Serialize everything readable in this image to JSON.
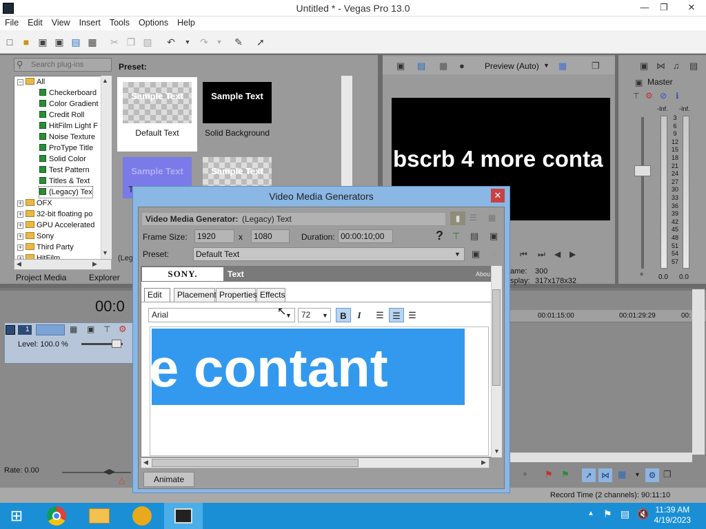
{
  "window": {
    "title": "Untitled * - Vegas Pro 13.0"
  },
  "menu": [
    "File",
    "Edit",
    "View",
    "Insert",
    "Tools",
    "Options",
    "Help"
  ],
  "plugins": {
    "search_placeholder": "Search plug-ins",
    "tree": [
      {
        "label": "All",
        "level": 0,
        "kind": "folder",
        "expanded": true
      },
      {
        "label": "Checkerboard",
        "level": 1,
        "kind": "plugin"
      },
      {
        "label": "Color Gradient",
        "level": 1,
        "kind": "plugin"
      },
      {
        "label": "Credit Roll",
        "level": 1,
        "kind": "plugin"
      },
      {
        "label": "HitFilm Light F",
        "level": 1,
        "kind": "plugin"
      },
      {
        "label": "Noise Texture",
        "level": 1,
        "kind": "plugin"
      },
      {
        "label": "ProType Title",
        "level": 1,
        "kind": "plugin"
      },
      {
        "label": "Solid Color",
        "level": 1,
        "kind": "plugin"
      },
      {
        "label": "Test Pattern",
        "level": 1,
        "kind": "plugin"
      },
      {
        "label": "Titles & Text",
        "level": 1,
        "kind": "plugin"
      },
      {
        "label": "(Legacy) Tex",
        "level": 1,
        "kind": "plugin",
        "selected": true
      },
      {
        "label": "OFX",
        "level": 0,
        "kind": "folder"
      },
      {
        "label": "32-bit floating po",
        "level": 0,
        "kind": "folder"
      },
      {
        "label": "GPU Accelerated",
        "level": 0,
        "kind": "folder"
      },
      {
        "label": "Sony",
        "level": 0,
        "kind": "folder"
      },
      {
        "label": "Third Party",
        "level": 0,
        "kind": "folder"
      },
      {
        "label": "HitFilm",
        "level": 0,
        "kind": "folder"
      }
    ],
    "tabs": [
      "Project Media",
      "Explorer"
    ],
    "preset_label": "Preset:",
    "presets": [
      {
        "thumb_text": "Sample Text",
        "caption": "Default Text"
      },
      {
        "thumb_text": "Sample Text",
        "caption": "Solid Background"
      },
      {
        "thumb_text": "Sample Text",
        "caption": "T"
      },
      {
        "thumb_text": "Sample Text",
        "caption": ""
      }
    ],
    "partial_caption": "(Leg"
  },
  "preview": {
    "mode": "Preview (Auto)",
    "text": "bscrb 4 more conta",
    "frame_label": "ame:",
    "frame_value": "300",
    "display_label": "splay:",
    "display_value": "317x178x32"
  },
  "mixer": {
    "title": "Master",
    "inf_left": "-Inf.",
    "inf_right": "-Inf.",
    "scale": [
      "3",
      "6",
      "9",
      "12",
      "15",
      "18",
      "21",
      "24",
      "27",
      "30",
      "33",
      "36",
      "39",
      "42",
      "45",
      "48",
      "51",
      "54",
      "57"
    ],
    "bottom_left": "0.0",
    "bottom_right": "0.0"
  },
  "timeline": {
    "time_partial": "00:0",
    "level": "Level: 100.0 %",
    "track_number": "1",
    "ruler": [
      "00:01:15:00",
      "00:01:29:29",
      "00:"
    ],
    "rate": "Rate: 0.00",
    "record_time": "Record Time (2 channels): 90:11:10"
  },
  "dialog": {
    "title": "Video Media Generators",
    "generator_label": "Video Media Generator:",
    "generator_value": "(Legacy) Text",
    "frame_size_label": "Frame Size:",
    "width": "1920",
    "x": "x",
    "height": "1080",
    "duration_label": "Duration:",
    "duration": "00:00:10;00",
    "preset_label": "Preset:",
    "preset_value": "Default Text",
    "brand": "SONY.",
    "plugin_name": "Text",
    "about": "Abou",
    "tabs": [
      "Edit",
      "Placement",
      "Properties",
      "Effects"
    ],
    "font": "Arial",
    "font_size": "72",
    "editor_text": "e contant",
    "animate": "Animate"
  },
  "taskbar": {
    "time": "11:39 AM",
    "date": "4/19/2023"
  }
}
